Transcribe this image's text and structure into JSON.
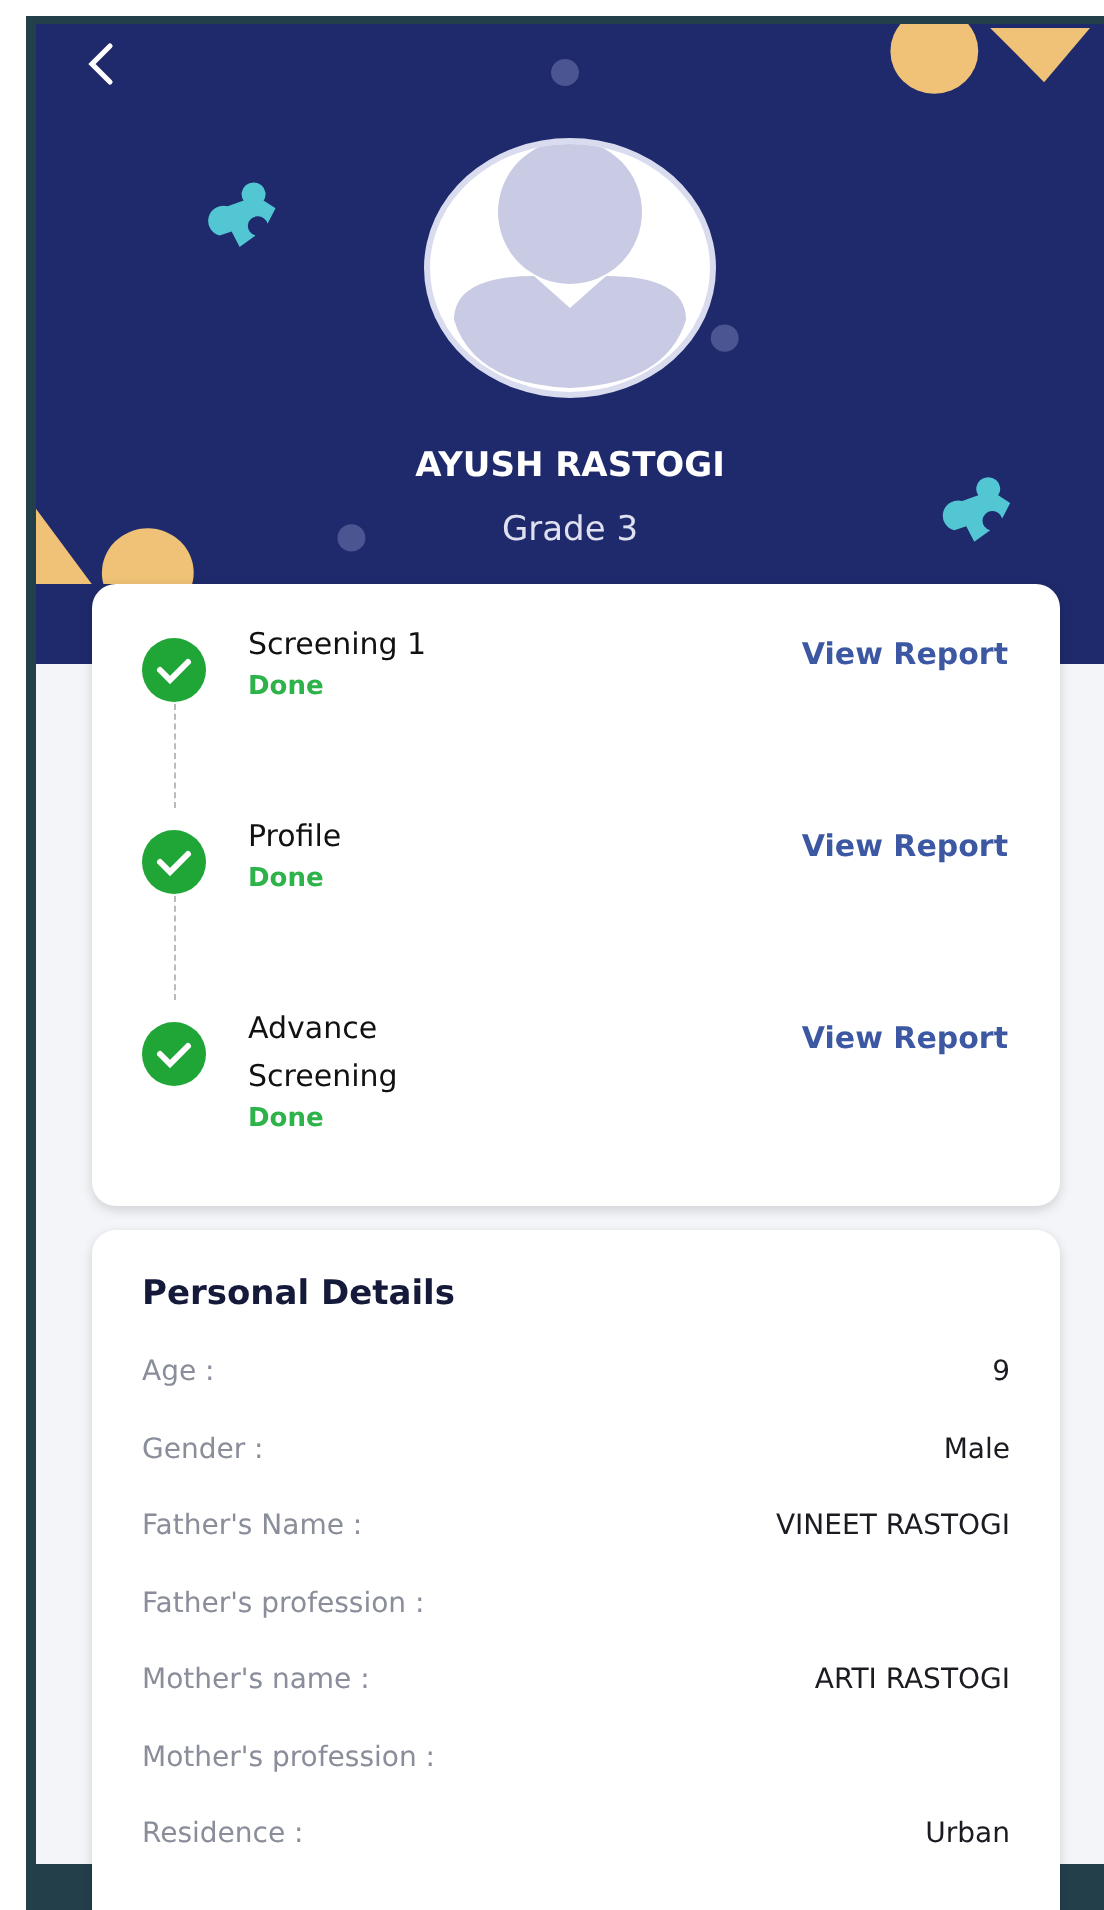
{
  "header": {
    "name": "AYUSH RASTOGI",
    "grade": "Grade 3"
  },
  "steps": [
    {
      "title": "Screening 1",
      "status": "Done",
      "completed": true,
      "action": "View Report"
    },
    {
      "title": "Profile",
      "status": "Done",
      "completed": true,
      "action": "View Report"
    },
    {
      "title": "Advance Screening",
      "status": "Done",
      "completed": true,
      "action": "View Report"
    }
  ],
  "personal_details": {
    "title": "Personal Details",
    "rows": [
      {
        "label": "Age :",
        "value": "9"
      },
      {
        "label": "Gender :",
        "value": "Male"
      },
      {
        "label": "Father's Name :",
        "value": "VINEET RASTOGI"
      },
      {
        "label": "Father's profession :"
      },
      {
        "label": "Mother's name :",
        "value": "ARTI RASTOGI"
      },
      {
        "label": "Mother's profession :"
      },
      {
        "label": "Residence :",
        "value": "Urban"
      }
    ]
  }
}
